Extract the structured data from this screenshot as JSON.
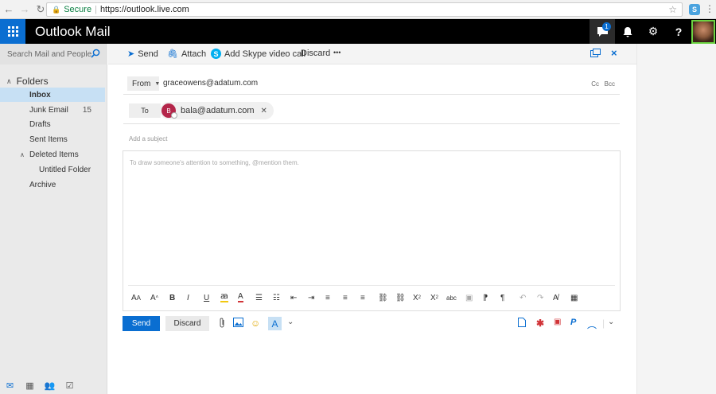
{
  "browser": {
    "secure_label": "Secure",
    "url": "https://outlook.live.com"
  },
  "appbar": {
    "title": "Outlook Mail",
    "notification_count": "1"
  },
  "sidebar": {
    "search_placeholder": "Search Mail and People",
    "folders_label": "Folders",
    "items": [
      {
        "label": "Inbox",
        "count": ""
      },
      {
        "label": "Junk Email",
        "count": "15"
      },
      {
        "label": "Drafts",
        "count": ""
      },
      {
        "label": "Sent Items",
        "count": ""
      },
      {
        "label": "Deleted Items",
        "count": ""
      },
      {
        "label": "Untitled Folder",
        "count": ""
      },
      {
        "label": "Archive",
        "count": ""
      }
    ]
  },
  "toolbar": {
    "send": "Send",
    "attach": "Attach",
    "skype": "Add Skype video call",
    "discard": "Discard",
    "more": "•••"
  },
  "compose": {
    "from_label": "From",
    "from_address": "graceowens@adatum.com",
    "cc": "Cc",
    "bcc": "Bcc",
    "to_label": "To",
    "recipient_initial": "B",
    "recipient": "bala@adatum.com",
    "subject_placeholder": "Add a subject",
    "body_placeholder": "To draw someone's attention to something, @mention them."
  },
  "actions": {
    "send": "Send",
    "discard": "Discard"
  },
  "colors": {
    "accent": "#0a6ed1",
    "appbar": "#000000",
    "selected": "#c7e0f4",
    "avatar": "#b4264a"
  }
}
